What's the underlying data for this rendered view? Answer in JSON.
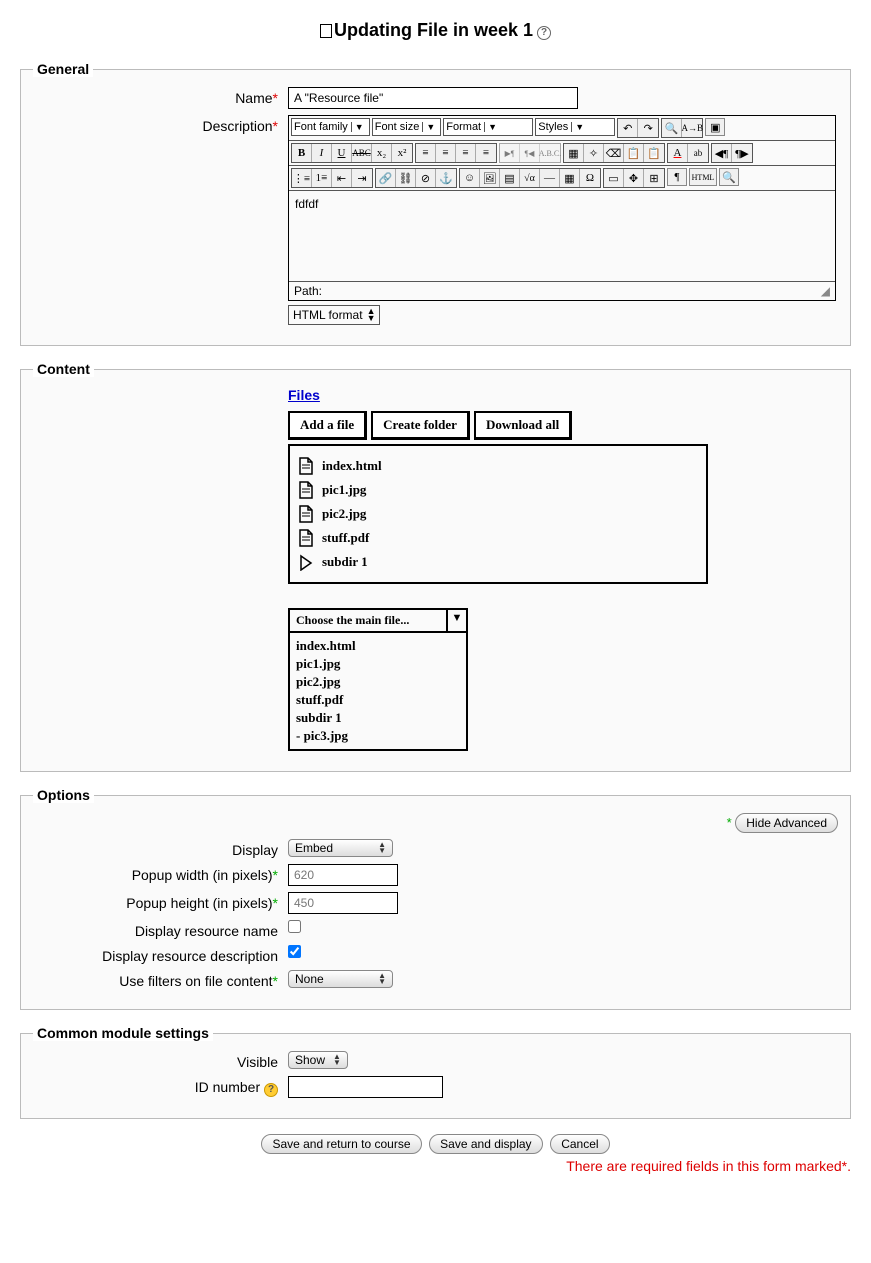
{
  "title": "Updating File in week 1",
  "sections": {
    "general": {
      "legend": "General",
      "name_label": "Name",
      "name_value": "A \"Resource file\"",
      "description_label": "Description",
      "toolbar": {
        "font_family": "Font family",
        "font_size": "Font size",
        "format": "Format",
        "styles": "Styles"
      },
      "editor_content": "fdfdf",
      "path_label": "Path:",
      "format_select": "HTML format"
    },
    "content": {
      "legend": "Content",
      "files_link": "Files",
      "add_file": "Add a file",
      "create_folder": "Create folder",
      "download_all": "Download all",
      "files": [
        "index.html",
        "pic1.jpg",
        "pic2.jpg",
        "stuff.pdf",
        "subdir 1"
      ],
      "mainfile_label": "Choose the main file...",
      "mainfile_options": [
        "index.html",
        "pic1.jpg",
        "pic2.jpg",
        "stuff.pdf",
        "subdir 1",
        " - pic3.jpg"
      ]
    },
    "options": {
      "legend": "Options",
      "hide_advanced": "Hide Advanced",
      "display_label": "Display",
      "display_value": "Embed",
      "popup_width_label": "Popup width (in pixels)",
      "popup_width_value": "620",
      "popup_height_label": "Popup height (in pixels)",
      "popup_height_value": "450",
      "display_name_label": "Display resource name",
      "display_desc_label": "Display resource description",
      "filters_label": "Use filters on file content",
      "filters_value": "None"
    },
    "common": {
      "legend": "Common module settings",
      "visible_label": "Visible",
      "visible_value": "Show",
      "idnumber_label": "ID number"
    }
  },
  "actions": {
    "save_return": "Save and return to course",
    "save_display": "Save and display",
    "cancel": "Cancel"
  },
  "required_note": "There are required fields in this form marked*."
}
